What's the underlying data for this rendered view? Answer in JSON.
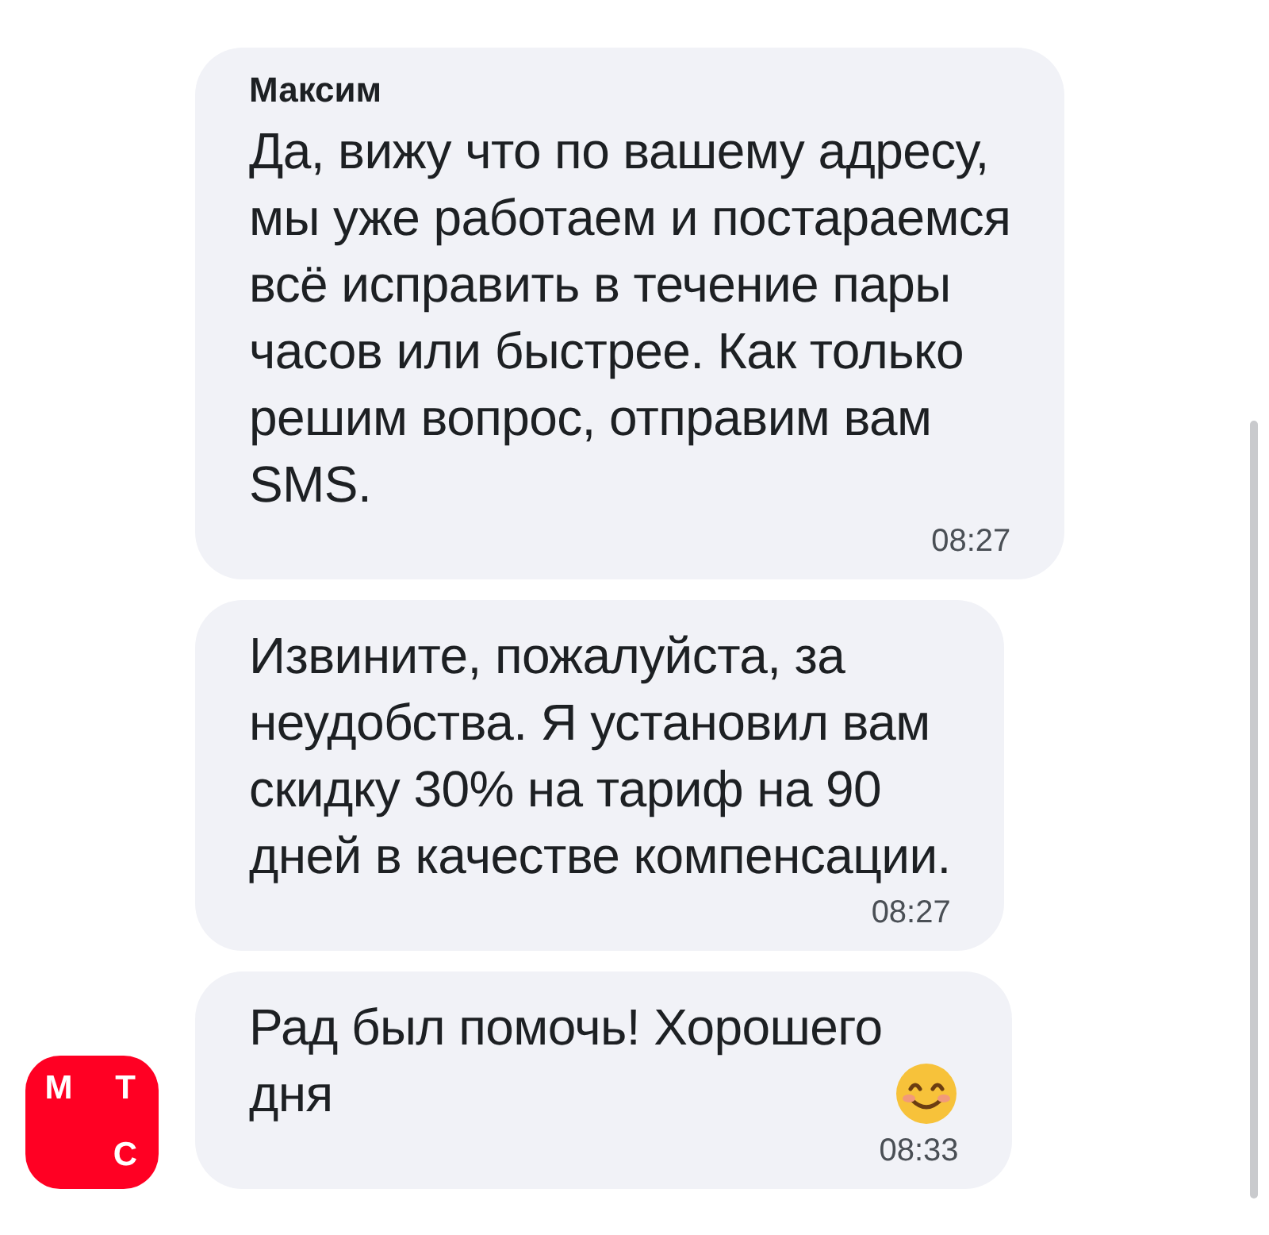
{
  "messages": [
    {
      "author": "Максим",
      "text": "Да, вижу что по вашему адресу,\nмы уже работаем и постараемся\nвсё исправить в течение пары\nчасов или быстрее. Как только\nрешим вопрос, отправим вам\nSMS.",
      "time": "08:27",
      "emoji": false,
      "avatar": false
    },
    {
      "text": "Извините, пожалуйста, за\nнеудобства. Я установил вам\nскидку 30% на тариф на 90\nдней в качестве компенсации.",
      "time": "08:27",
      "emoji": false,
      "avatar": false
    },
    {
      "text": "Рад был помочь! Хорошего\nдня",
      "time": "08:33",
      "emoji": true,
      "avatar": true,
      "avatar_letters": [
        "М",
        "Т",
        "С"
      ]
    }
  ]
}
